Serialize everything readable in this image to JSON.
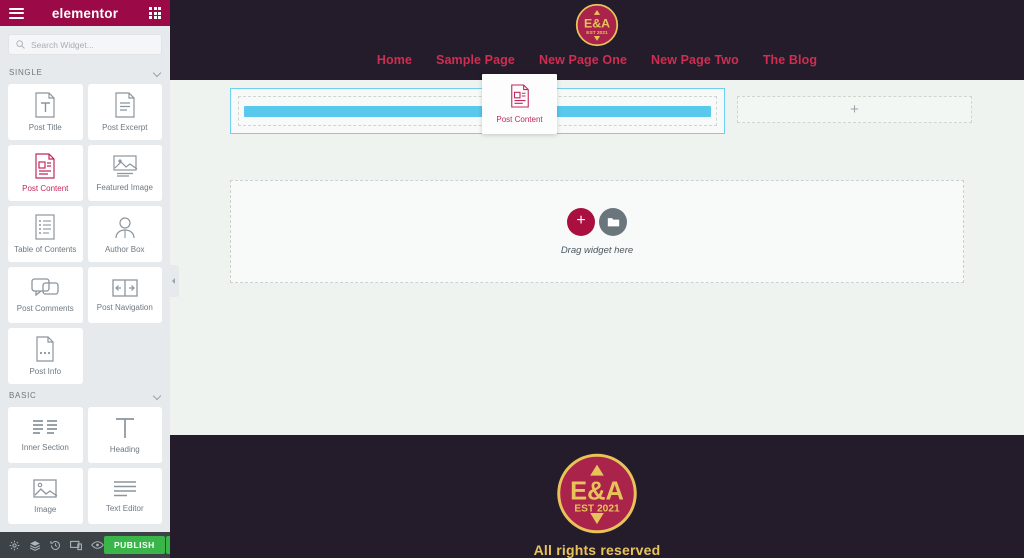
{
  "panel": {
    "header": {
      "logo_text": "elementor",
      "menu_icon": "hamburger-icon",
      "widgets_icon": "grid-icon"
    },
    "search": {
      "placeholder": "Search Widget...",
      "value": "",
      "icon": "search-icon"
    },
    "categories": [
      {
        "label": "SINGLE",
        "widgets": [
          {
            "label": "Post Title",
            "icon": "post-title-icon",
            "active": false
          },
          {
            "label": "Post Excerpt",
            "icon": "post-excerpt-icon",
            "active": false
          },
          {
            "label": "Post Content",
            "icon": "post-content-icon",
            "active": true
          },
          {
            "label": "Featured Image",
            "icon": "featured-image-icon",
            "active": false
          },
          {
            "label": "Table of Contents",
            "icon": "table-of-contents-icon",
            "active": false
          },
          {
            "label": "Author Box",
            "icon": "author-box-icon",
            "active": false
          },
          {
            "label": "Post Comments",
            "icon": "post-comments-icon",
            "active": false
          },
          {
            "label": "Post Navigation",
            "icon": "post-navigation-icon",
            "active": false
          },
          {
            "label": "Post Info",
            "icon": "post-info-icon",
            "active": false
          }
        ]
      },
      {
        "label": "BASIC",
        "widgets": [
          {
            "label": "Inner Section",
            "icon": "inner-section-icon",
            "active": false
          },
          {
            "label": "Heading",
            "icon": "heading-icon",
            "active": false
          },
          {
            "label": "Image",
            "icon": "image-icon",
            "active": false
          },
          {
            "label": "Text Editor",
            "icon": "text-editor-icon",
            "active": false
          }
        ]
      }
    ],
    "footer": {
      "icons": [
        "settings-gear-icon",
        "navigator-layers-icon",
        "history-icon",
        "responsive-mode-icon",
        "preview-eye-icon"
      ],
      "publish_label": "PUBLISH",
      "publish_caret_icon": "caret-up-icon"
    },
    "collapse_handle_icon": "chevron-right-icon"
  },
  "drag_ghost": {
    "label": "Post Content",
    "icon": "post-content-icon"
  },
  "site": {
    "header": {
      "logo": {
        "initials": "E&A",
        "established": "EST 2021"
      },
      "nav": [
        {
          "label": "Home"
        },
        {
          "label": "Sample Page"
        },
        {
          "label": "New Page One"
        },
        {
          "label": "New Page Two"
        },
        {
          "label": "The Blog"
        }
      ]
    },
    "canvas": {
      "left_column": {
        "drop_indicator": true
      },
      "right_column": {
        "add_icon": "plus-icon"
      },
      "empty_section": {
        "add_section_icon": "plus-icon",
        "template_icon": "folder-template-icon",
        "hint": "Drag widget here"
      }
    },
    "footer": {
      "logo": {
        "initials": "E&A",
        "established": "EST 2021"
      },
      "rights": "All rights reserved"
    }
  },
  "colors": {
    "elementor_brand": "#9b0a46",
    "accent_pink": "#c2285c",
    "site_dark": "#241b2b",
    "site_crimson": "#a9234a",
    "site_gold": "#e8c35a",
    "nav_link": "#cf2e50",
    "drop_indicator": "#59c8ed",
    "publish_green": "#39b54a",
    "canvas_bg": "#eef3ef"
  }
}
